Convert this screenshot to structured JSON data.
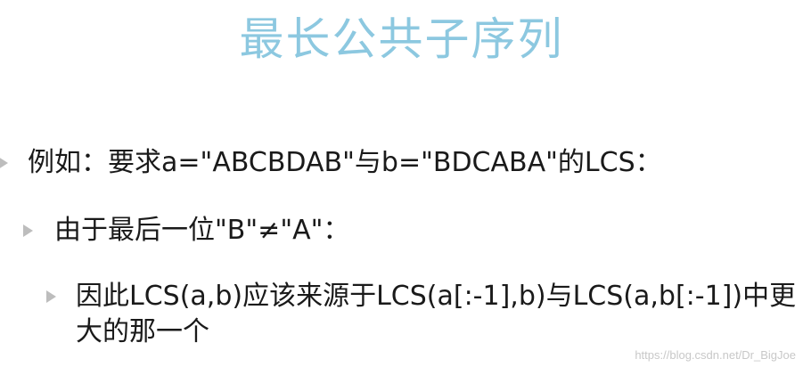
{
  "title": "最长公共子序列",
  "bullets": [
    {
      "text": "例如：要求a=\"ABCBDAB\"与b=\"BDCABA\"的LCS："
    },
    {
      "text": "由于最后一位\"B\"≠\"A\"："
    },
    {
      "text": "因此LCS(a,b)应该来源于LCS(a[:-1],b)与LCS(a,b[:-1])中更大的那一个"
    }
  ],
  "watermark": "https://blog.csdn.net/Dr_BigJoe",
  "colors": {
    "title": "#8cc8e0",
    "bullet_marker": "#bdbdbd",
    "text": "#1a1a1a"
  }
}
